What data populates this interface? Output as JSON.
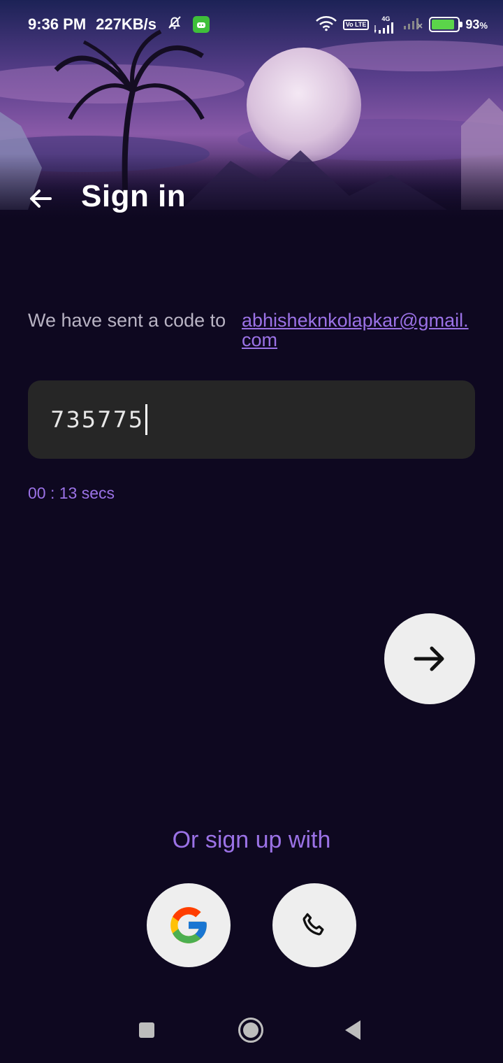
{
  "status_bar": {
    "time": "9:36 PM",
    "speed": "227KB/s",
    "network": "4G",
    "volte": "Vo LTE",
    "battery": "93",
    "battery_unit": "%"
  },
  "header": {
    "title": "Sign in"
  },
  "message": {
    "prefix": "We have sent a code to",
    "email": "abhisheknkolapkar@gmail.com"
  },
  "code_input": {
    "value": "735775"
  },
  "timer": {
    "text": "00 : 13 secs"
  },
  "alternatives": {
    "label": "Or sign up with"
  },
  "colors": {
    "background": "#0e0820",
    "accent": "#9b72e6",
    "input_bg": "#262626",
    "button_bg": "#eeeeee"
  }
}
